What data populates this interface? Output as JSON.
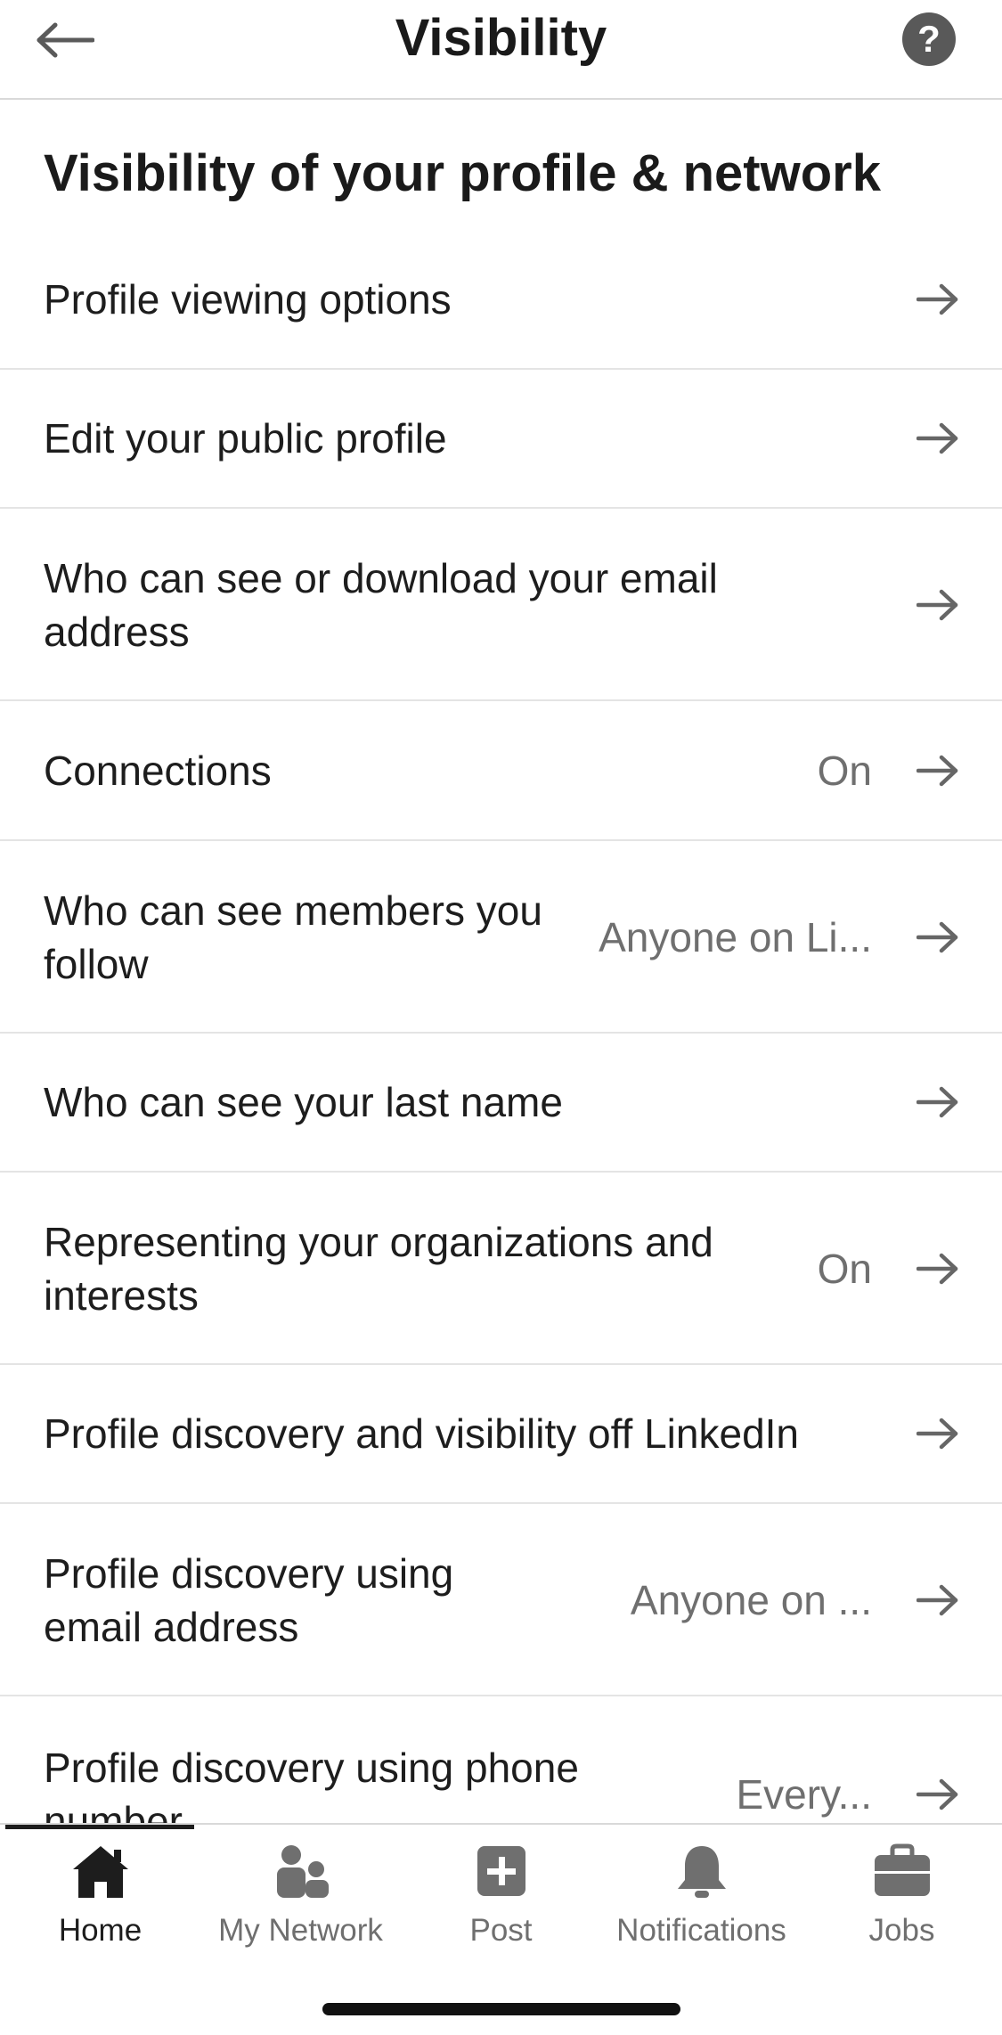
{
  "header": {
    "title": "Visibility",
    "back_icon": "arrow-left-icon",
    "help_icon": "question-circle-icon",
    "help_glyph": "?"
  },
  "section": {
    "title": "Visibility of your profile & network"
  },
  "rows": [
    {
      "label": "Profile viewing options",
      "value": ""
    },
    {
      "label": "Edit your public profile",
      "value": ""
    },
    {
      "label": "Who can see or download your email address",
      "value": ""
    },
    {
      "label": "Connections",
      "value": "On"
    },
    {
      "label": "Who can see members you follow",
      "value": "Anyone on Li..."
    },
    {
      "label": "Who can see your last name",
      "value": ""
    },
    {
      "label": "Representing your organizations and interests",
      "value": "On"
    },
    {
      "label": "Profile discovery and visibility off LinkedIn",
      "value": ""
    },
    {
      "label": "Profile discovery using email address",
      "value": "Anyone on ..."
    },
    {
      "label": "Profile discovery using phone number",
      "value": "Every..."
    }
  ],
  "tabbar": {
    "tabs": [
      {
        "label": "Home",
        "icon": "home-icon",
        "active": true
      },
      {
        "label": "My Network",
        "icon": "people-icon",
        "active": false
      },
      {
        "label": "Post",
        "icon": "plus-square-icon",
        "active": false
      },
      {
        "label": "Notifications",
        "icon": "bell-icon",
        "active": false
      },
      {
        "label": "Jobs",
        "icon": "briefcase-icon",
        "active": false
      }
    ]
  },
  "colors": {
    "text": "#1d1d1d",
    "secondary_text": "#6f6f6f",
    "divider": "#e4e4e4",
    "icon_gray": "#666666"
  }
}
